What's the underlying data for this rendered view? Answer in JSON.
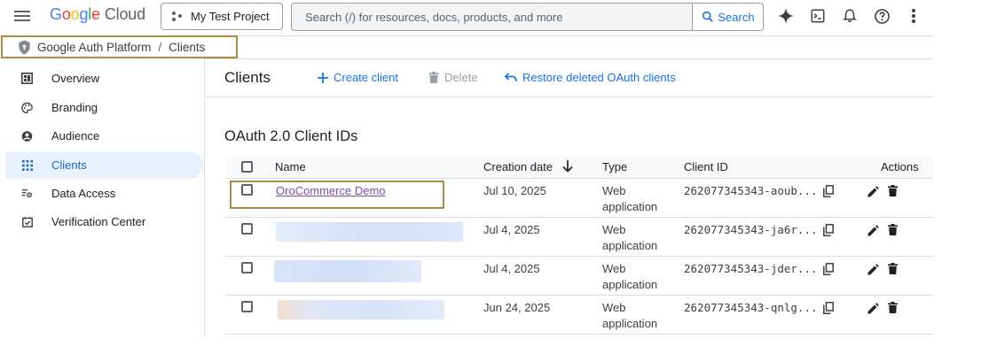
{
  "app": {
    "logo_letters": [
      "G",
      "o",
      "o",
      "g",
      "l",
      "e"
    ],
    "logo_product": "Cloud",
    "project_name": "My Test Project",
    "search_placeholder": "Search (/) for resources, docs, products, and more",
    "search_button": "Search"
  },
  "breadcrumb": {
    "root": "Google Auth Platform",
    "separator": "/",
    "current": "Clients"
  },
  "sidebar": {
    "items": [
      {
        "label": "Overview",
        "icon": "overview-icon",
        "active": false
      },
      {
        "label": "Branding",
        "icon": "palette-icon",
        "active": false
      },
      {
        "label": "Audience",
        "icon": "person-icon",
        "active": false
      },
      {
        "label": "Clients",
        "icon": "grid-icon",
        "active": true
      },
      {
        "label": "Data Access",
        "icon": "data-settings-icon",
        "active": false
      },
      {
        "label": "Verification Center",
        "icon": "check-box-icon",
        "active": false
      }
    ]
  },
  "main": {
    "title": "Clients",
    "actions": {
      "create": "Create client",
      "delete": "Delete",
      "restore": "Restore deleted OAuth clients"
    },
    "section_title": "OAuth 2.0 Client IDs",
    "table": {
      "headers": {
        "name": "Name",
        "creation_date": "Creation date",
        "type": "Type",
        "client_id": "Client ID",
        "actions": "Actions"
      },
      "rows": [
        {
          "name": "OroCommerce Demo",
          "name_redacted": false,
          "date": "Jul 10, 2025",
          "type": "Web application",
          "client_id": "262077345343-aoub..."
        },
        {
          "name": "",
          "name_redacted": true,
          "date": "Jul 4, 2025",
          "type": "Web application",
          "client_id": "262077345343-ja6r..."
        },
        {
          "name": "",
          "name_redacted": true,
          "date": "Jul 4, 2025",
          "type": "Web application",
          "client_id": "262077345343-jder..."
        },
        {
          "name": "",
          "name_redacted": true,
          "date": "Jun 24, 2025",
          "type": "Web application",
          "client_id": "262077345343-qnlg..."
        }
      ]
    }
  },
  "colors": {
    "accent": "#1a73e8",
    "active_bg": "#e8f0fe",
    "highlight_border": "#b08a45",
    "link_visited": "#7b4ca8"
  }
}
